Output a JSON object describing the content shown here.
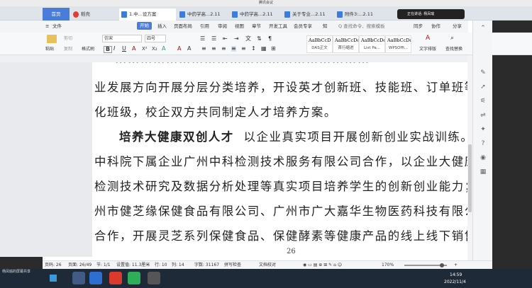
{
  "meeting_title": "腾讯会议",
  "tabs": {
    "home": "首页",
    "daoke": "稻壳",
    "t1": "1.中...设方案",
    "t2": "中药学高...2.11",
    "t3": "中药学高...2.11",
    "t4": "关于专业...2.11",
    "t5": "附件3:...2.11"
  },
  "speaking": "正在讲话: 杨凤瑜",
  "ribbon_tabs": [
    "文件",
    "开始",
    "插入",
    "页面布局",
    "引用",
    "审阅",
    "视图",
    "章节",
    "开发工具",
    "会员专享",
    "知"
  ],
  "search_placeholder": "Q 查找命令、搜索模板",
  "ribbon_right": {
    "sync": "同步",
    "collab": "协作",
    "share": "分享"
  },
  "ribbon": {
    "paste": "粘贴",
    "cut": "剪切",
    "copy": "复制",
    "format_painter": "格式刷",
    "font_name": "仿宋",
    "font_size": "四号",
    "bold": "B",
    "styles": [
      {
        "sample": "AaBbCcD",
        "name": "DAS正文"
      },
      {
        "sample": "AaBbCcDd",
        "name": "首行缩进"
      },
      {
        "sample": "AaBbCcDd",
        "name": "List Pa..."
      },
      {
        "sample": "AaBbCcDd",
        "name": "WPSOffi..."
      }
    ],
    "text_layout": "文字排版",
    "find_replace": "查找替换",
    "select": "选择"
  },
  "document": {
    "lines": [
      "业发展方向开展分层分类培养，开设英才创新班、技能班、订单班等",
      "化班级，校企双方共同制定人才培养方案。",
      "以企业真实项目开展创新创业实战训练。如",
      "中科院下属企业广州中科检测技术服务有限公司合作，以企业大健康",
      "检测技术研究及数据分析处理等真实项目培养学生的创新创业能力；",
      "州市健芝缘保健食品有限公司、广州市广大嘉华生物医药科技有限公",
      "合作，开展灵芝系列保健食品、保健酵素等健康产品的线上线下销售"
    ],
    "bold_lead": "培养大健康双创人才",
    "page_number": "26"
  },
  "status": {
    "page_num": "页码: 26",
    "pages": "页面: 26/49",
    "section": "节: 1/1",
    "setting": "设置值: 11.3厘米",
    "row": "行: 10",
    "col": "列: 14",
    "word_count": "字数: 31167",
    "spell_check": "拼写检查",
    "doc_check": "文档校对",
    "zoom": "170%"
  },
  "taskbar": {
    "presenter": "杨凤瑜的屏幕共享",
    "time": "14:59",
    "date": "2022/11/4"
  }
}
